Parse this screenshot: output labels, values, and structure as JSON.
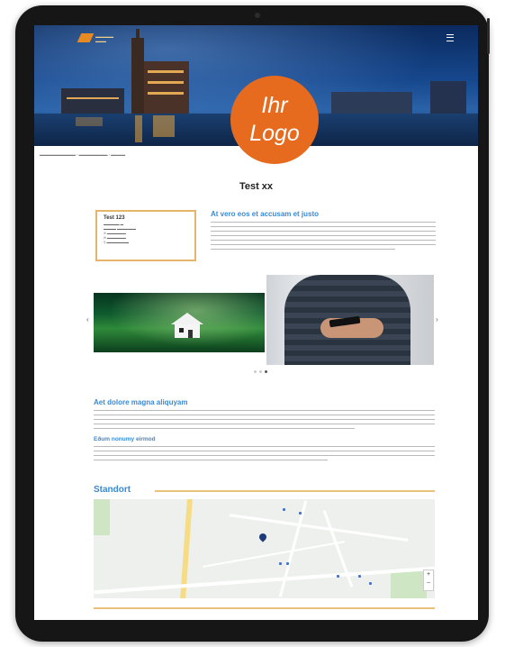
{
  "badge": {
    "line1": "Ihr",
    "line2": "Logo"
  },
  "page": {
    "title": "Test xx"
  },
  "contact": {
    "name": "Test 123"
  },
  "intro": {
    "heading": "At vero eos et accusam et justo"
  },
  "section1": {
    "heading": "Aet dolore magna aliquyam",
    "subheading": "Eðum nonumy eirmod"
  },
  "location": {
    "heading": "Standort"
  },
  "colors": {
    "accent": "#e66b1f",
    "heading_blue": "#3a8ad0",
    "rule_gold": "#e8c27a",
    "frame": "#161616"
  }
}
